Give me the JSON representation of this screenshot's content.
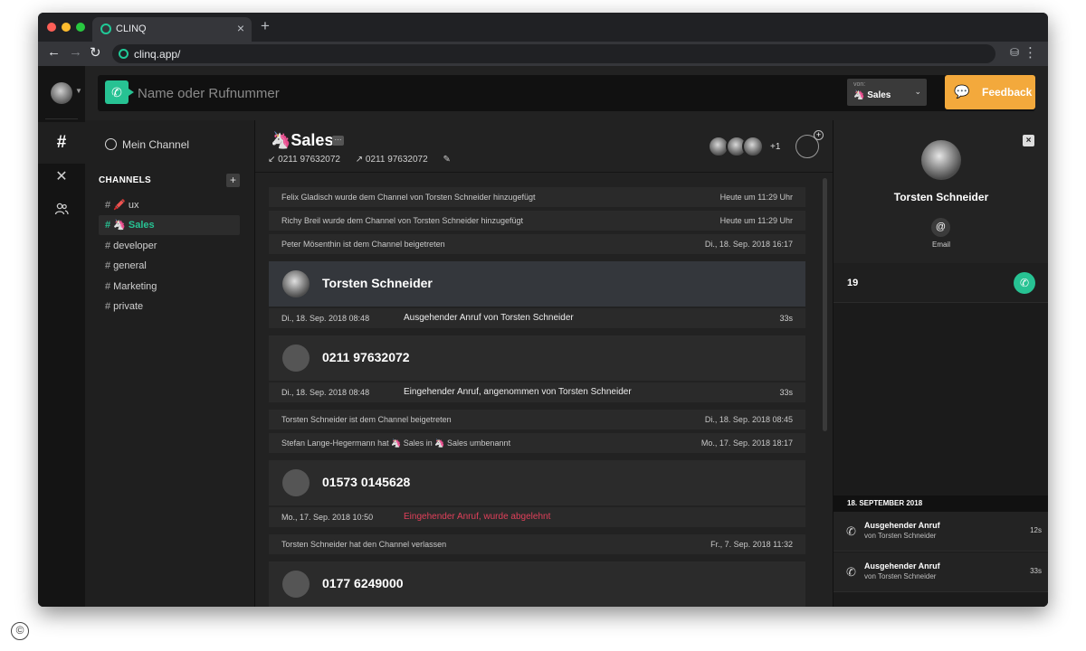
{
  "browser": {
    "tab_title": "CLINQ",
    "tab_close": "×",
    "new_tab": "+",
    "url": "clinq.app/",
    "icons": [
      "back-arrow-icon",
      "forward-arrow-icon",
      "reload-icon",
      "extension-icon",
      "kebab-menu-icon"
    ]
  },
  "callbar": {
    "placeholder": "Name oder Rufnummer",
    "from_label": "von:",
    "from_value": "🦄 Sales",
    "feedback_label": "Feedback"
  },
  "sidebar": {
    "mein_channel": "Mein Channel",
    "channels_heading": "CHANNELS",
    "add_label": "+",
    "channels": [
      {
        "name": "🖍️ ux",
        "active": false
      },
      {
        "name": "🦄 Sales",
        "active": true
      },
      {
        "name": "developer",
        "active": false
      },
      {
        "name": "general",
        "active": false
      },
      {
        "name": "Marketing",
        "active": false
      },
      {
        "name": "private",
        "active": false
      }
    ]
  },
  "channel": {
    "title": "🦄Sales",
    "more": "···",
    "number_in": "0211 97632072",
    "number_out": "0211 97632072",
    "member_extra": "+1"
  },
  "feed": {
    "events": [
      {
        "text": "Felix Gladisch wurde dem Channel von Torsten Schneider hinzugefügt",
        "time": "Heute um 11:29 Uhr"
      },
      {
        "text": "Richy Breil wurde dem Channel von Torsten Schneider hinzugefügt",
        "time": "Heute um 11:29 Uhr"
      },
      {
        "text": "Peter Mösenthin ist dem Channel beigetreten",
        "time": "Di., 18. Sep. 2018 16:17"
      },
      {
        "text": "Torsten Schneider ist dem Channel beigetreten",
        "time": "Di., 18. Sep. 2018 08:45"
      },
      {
        "text": "Stefan Lange-Hegermann hat 🦄 Sales in 🦄 Sales umbenannt",
        "time": "Mo., 17. Sep. 2018 18:17"
      },
      {
        "text": "Torsten Schneider hat den Channel verlassen",
        "time": "Fr., 7. Sep. 2018 11:32"
      }
    ],
    "calls": [
      {
        "name": "Torsten Schneider",
        "date": "Di., 18. Sep. 2018 08:48",
        "text": "Ausgehender Anruf von Torsten Schneider",
        "duration": "33s"
      },
      {
        "name": "0211 97632072",
        "date": "Di., 18. Sep. 2018 08:48",
        "text": "Eingehender Anruf, angenommen von Torsten Schneider",
        "duration": "33s"
      },
      {
        "name": "01573 0145628",
        "date": "Mo., 17. Sep. 2018 10:50",
        "text": "Eingehender Anruf, wurde abgelehnt",
        "duration": ""
      },
      {
        "name": "0177 6249000"
      }
    ]
  },
  "contact": {
    "close": "×",
    "name": "Torsten Schneider",
    "email_symbol": "@",
    "email_label": "Email",
    "number": "19",
    "date_heading": "18. SEPTEMBER 2018",
    "history": [
      {
        "title": "Ausgehender Anruf",
        "sub": "von Torsten Schneider",
        "duration": "12s"
      },
      {
        "title": "Ausgehender Anruf",
        "sub": "von Torsten Schneider",
        "duration": "33s"
      }
    ]
  },
  "colors": {
    "accent_green": "#27c293",
    "feedback_orange": "#f3a93c",
    "rejected_red": "#e0405a"
  }
}
